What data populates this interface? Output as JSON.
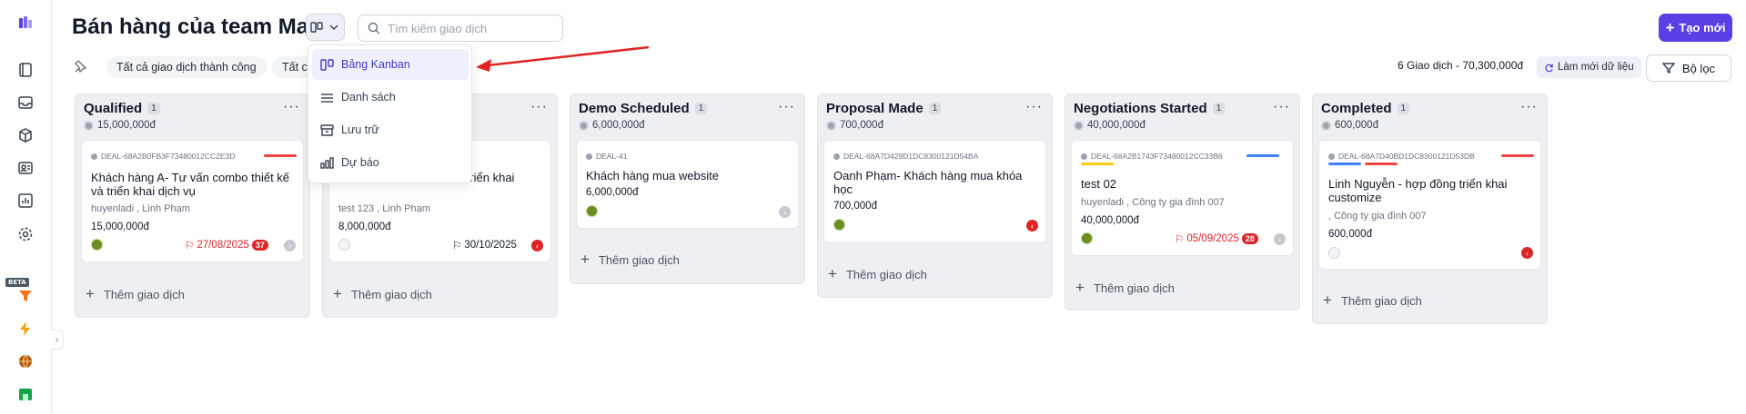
{
  "header": {
    "title": "Bán hàng của team Mai",
    "search_placeholder": "Tìm kiếm giao dịch",
    "new_button": "Tạo mới"
  },
  "filters": {
    "chips": [
      "Tất cả giao dịch thành công",
      "Tất c"
    ],
    "summary": "6 Giao dịch - 70,300,000đ",
    "refresh": "Làm mới dữ liệu",
    "filter_button": "Bộ lọc"
  },
  "view_menu": {
    "items": [
      {
        "label": "Bảng Kanban",
        "icon": "kanban-icon",
        "active": true
      },
      {
        "label": "Danh sách",
        "icon": "list-icon"
      },
      {
        "label": "Lưu trữ",
        "icon": "archive-icon"
      },
      {
        "label": "Dự báo",
        "icon": "forecast-icon"
      }
    ]
  },
  "add_deal_label": "Thêm giao dịch",
  "columns": [
    {
      "name": "Qualified",
      "count": "1",
      "total": "15,000,000đ",
      "card": {
        "id": "DEAL-68A2B0FB3F73480012CC2E3D",
        "title": "Khách hàng A- Tư vấn combo thiết kế và triển khai dịch vụ",
        "people": "huyenladi , Linh Phạm",
        "amount": "15,000,000đ",
        "date": "27/08/2025",
        "badge": "37",
        "date_color": "#dc2626",
        "bars": [
          "#ef4444"
        ]
      }
    },
    {
      "name": "",
      "count": "",
      "total": "",
      "card": {
        "id": "",
        "title": "ch vụ triển khai",
        "people": "test 123 , Linh Phạm",
        "amount": "8,000,000đ",
        "date": "30/10/2025",
        "badge": "",
        "date_color": "#111827",
        "bars": []
      }
    },
    {
      "name": "Demo Scheduled",
      "count": "1",
      "total": "6,000,000đ",
      "card": {
        "id": "DEAL-41",
        "title": "Khách hàng mua website",
        "people": "",
        "amount": "6,000,000đ",
        "date": "",
        "badge": "",
        "date_color": "#111827",
        "bars": []
      }
    },
    {
      "name": "Proposal Made",
      "count": "1",
      "total": "700,000đ",
      "card": {
        "id": "DEAL-68A7D429D1DC8300121D54BA",
        "title": "Oanh Phạm- Khách hàng mua khóa học",
        "people": "",
        "amount": "700,000đ",
        "date": "",
        "badge": "",
        "date_color": "#111827",
        "bars": []
      }
    },
    {
      "name": "Negotiations Started",
      "count": "1",
      "total": "40,000,000đ",
      "card": {
        "id": "DEAL-68A2B1743F73480012CC33B6",
        "title": "test 02",
        "people": "huyenladi , Công ty gia đình 007",
        "amount": "40,000,000đ",
        "date": "05/09/2025",
        "badge": "28",
        "date_color": "#dc2626",
        "bars": [
          "#3b82f6",
          "#facc15"
        ]
      }
    },
    {
      "name": "Completed",
      "count": "1",
      "total": "600,000đ",
      "card": {
        "id": "DEAL-68A7D40BD1DC8300121D53DB",
        "title": "Linh Nguyễn - hợp đồng triển khai customize",
        "people": ", Công ty gia đình 007",
        "amount": "600,000đ",
        "date": "",
        "badge": "",
        "date_color": "#111827",
        "bars": [
          "#ef4444",
          "#3b82f6",
          "#ef4444"
        ]
      }
    }
  ],
  "sidebar": {
    "items": [
      "logo-icon",
      "book-icon",
      "inbox-icon",
      "box-icon",
      "contact-icon",
      "chart-icon",
      "settings-icon",
      "funnel-icon",
      "lightning-icon",
      "globe-icon",
      "store-icon"
    ],
    "beta": "BETA"
  }
}
